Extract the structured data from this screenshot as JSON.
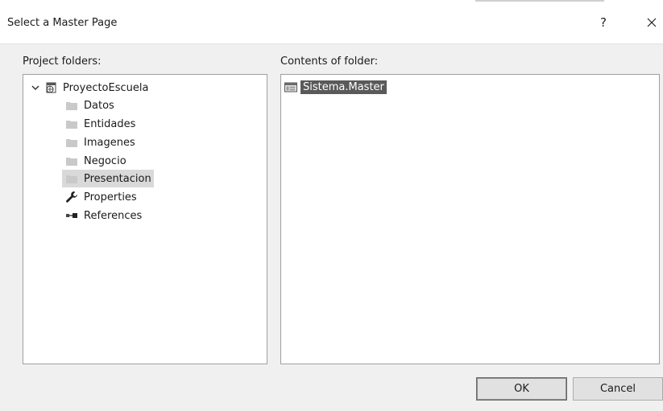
{
  "dialog": {
    "title": "Select a Master Page",
    "help_label": "?"
  },
  "left_panel": {
    "label": "Project folders:",
    "tree": [
      {
        "label": "ProyectoEscuela",
        "icon": "web-project-icon",
        "level": 0,
        "expanded": true
      },
      {
        "label": "Datos",
        "icon": "folder-icon",
        "level": 1
      },
      {
        "label": "Entidades",
        "icon": "folder-icon",
        "level": 1
      },
      {
        "label": "Imagenes",
        "icon": "folder-icon",
        "level": 1
      },
      {
        "label": "Negocio",
        "icon": "folder-icon",
        "level": 1
      },
      {
        "label": "Presentacion",
        "icon": "folder-icon",
        "level": 1,
        "selected": true
      },
      {
        "label": "Properties",
        "icon": "wrench-icon",
        "level": 1
      },
      {
        "label": "References",
        "icon": "references-icon",
        "level": 1
      }
    ]
  },
  "right_panel": {
    "label": "Contents of folder:",
    "files": [
      {
        "label": "Sistema.Master",
        "icon": "master-page-icon",
        "selected": true
      }
    ]
  },
  "buttons": {
    "ok_label": "OK",
    "cancel_label": "Cancel"
  }
}
